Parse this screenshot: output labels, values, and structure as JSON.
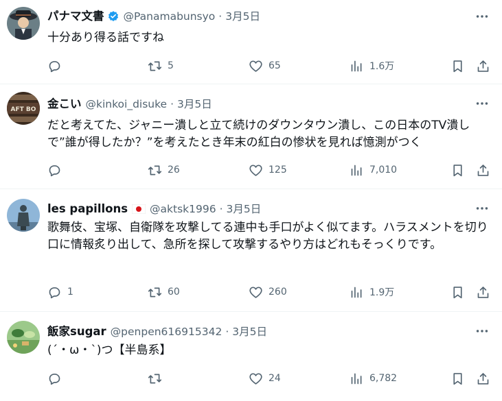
{
  "colors": {
    "text": "#0f1419",
    "secondary": "#536471",
    "verified": "#1d9bf0",
    "divider": "#eff3f4"
  },
  "tweets": [
    {
      "display_name": "パナマ文書",
      "handle": "@Panamabunsyo",
      "separator": "·",
      "date": "3月5日",
      "verified": true,
      "text": "十分あり得る話ですね",
      "replies": "",
      "retweets": "5",
      "likes": "65",
      "views": "1.6万"
    },
    {
      "display_name": "金こい",
      "handle": "@kinkoi_disuke",
      "separator": "·",
      "date": "3月5日",
      "text": "だと考えてた、ジャニー潰しと立て続けのダウンタウン潰し、この日本のTV潰しで”誰が得したか？”を考えたとき年末の紅白の惨状を見れば憶測がつく",
      "replies": "",
      "retweets": "26",
      "likes": "125",
      "views": "7,010"
    },
    {
      "display_name": "les papillons",
      "handle": "@aktsk1996",
      "separator": "·",
      "date": "3月5日",
      "flag": "japan-flag-icon",
      "text": "歌舞伎、宝塚、自衛隊を攻撃してる連中も手口がよく似てます。ハラスメントを切り口に情報炙り出して、急所を探して攻撃するやり方はどれもそっくりです。",
      "replies": "1",
      "retweets": "60",
      "likes": "260",
      "views": "1.9万"
    },
    {
      "display_name": "飯家sugar",
      "handle": "@penpen616915342",
      "separator": "·",
      "date": "3月5日",
      "text": "(´・ω・`)つ【半島系】",
      "replies": "",
      "retweets": "",
      "likes": "24",
      "views": "6,782"
    }
  ]
}
